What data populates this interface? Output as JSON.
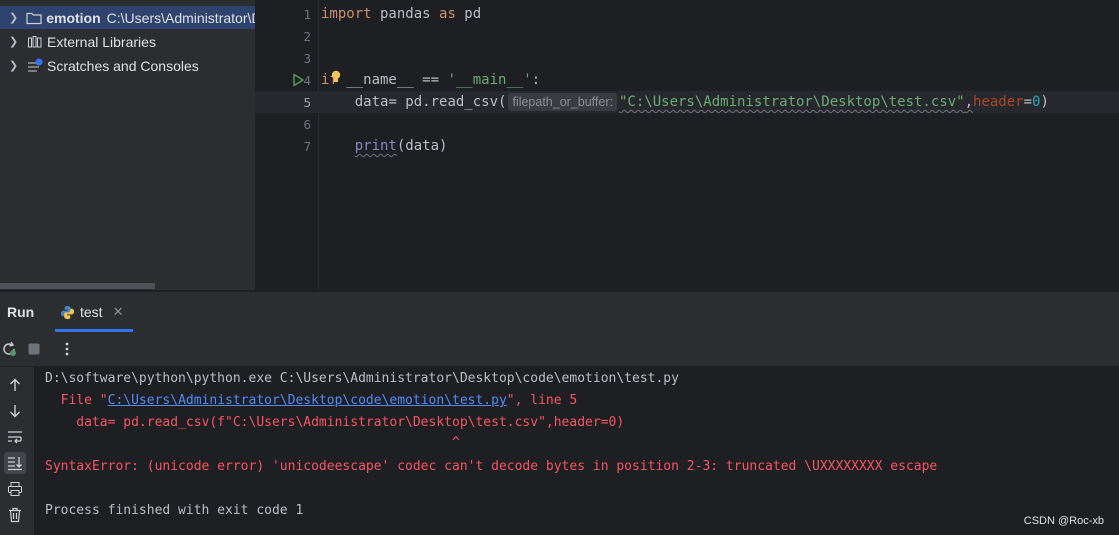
{
  "project": {
    "items": [
      {
        "label": "emotion",
        "path": "C:\\Users\\Administrator\\Desktop\\code\\emotion"
      },
      {
        "label": "External Libraries"
      },
      {
        "label": "Scratches and Consoles"
      }
    ]
  },
  "editor": {
    "line_numbers": [
      "1",
      "2",
      "3",
      "4",
      "5",
      "6",
      "7"
    ],
    "line1": {
      "kw_import": "import",
      "module": " pandas ",
      "kw_as": "as",
      "alias": " pd"
    },
    "line4": {
      "kw_if": "if",
      "name": " __name__ ",
      "op": "== ",
      "str": "'__main__'",
      "colon": ":"
    },
    "line5": {
      "indent": "    ",
      "lhs": "data",
      "assign": "= pd.read_csv(",
      "hint": "filepath_or_buffer:",
      "str": "\"C:\\Users\\Administrator\\Desktop\\test.csv\"",
      "comma": ",",
      "named_arg": "header",
      "eq": "=",
      "num": "0",
      "close": ")"
    },
    "line7": {
      "indent": "    ",
      "fn": "print",
      "args": "(data)"
    }
  },
  "run": {
    "title": "Run",
    "tab_label": "test",
    "console": {
      "cmd": "D:\\software\\python\\python.exe C:\\Users\\Administrator\\Desktop\\code\\emotion\\test.py",
      "file_prefix": "  File \"",
      "file_link": "C:\\Users\\Administrator\\Desktop\\code\\emotion\\test.py",
      "file_suffix": "\", line 5",
      "code_line": "    data= pd.read_csv(f\"C:\\Users\\Administrator\\Desktop\\test.csv\",header=0)",
      "caret": "                                                    ^",
      "error": "SyntaxError: (unicode error) 'unicodeescape' codec can't decode bytes in position 2-3: truncated \\UXXXXXXXX escape",
      "exit": "Process finished with exit code 1"
    }
  },
  "watermark": "CSDN @Roc-xb"
}
